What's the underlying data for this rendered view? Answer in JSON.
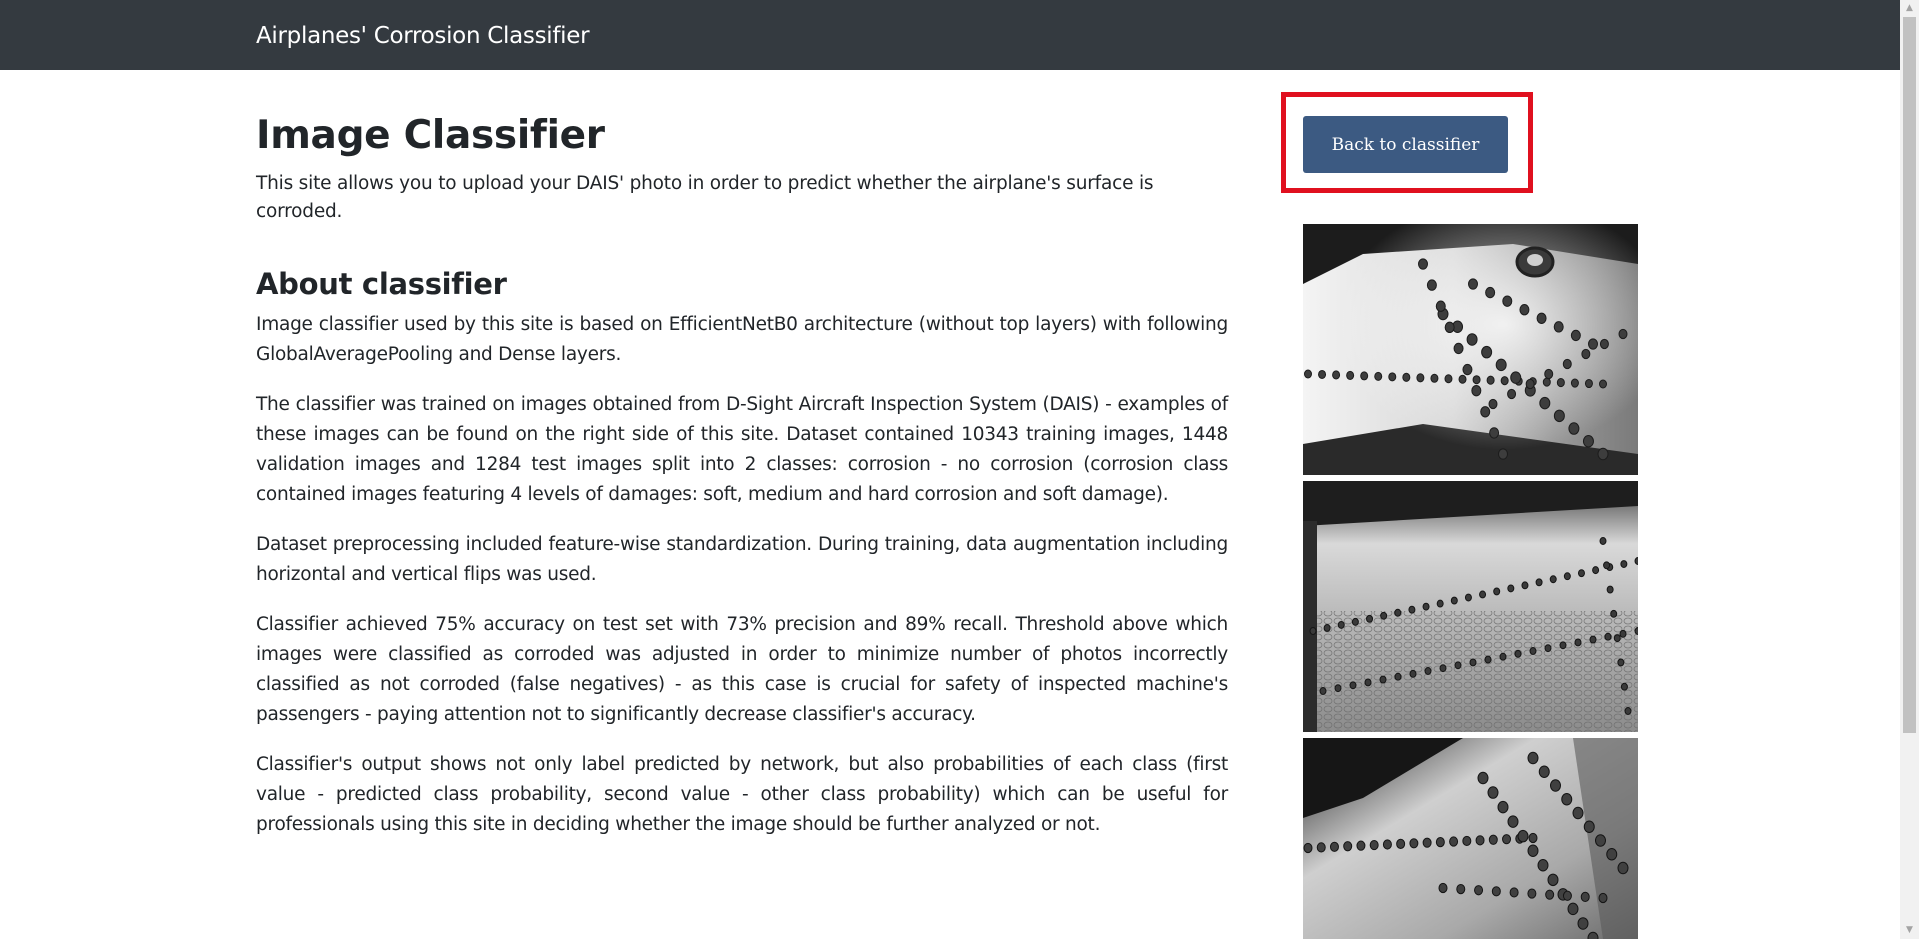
{
  "navbar": {
    "brand": "Airplanes' Corrosion Classifier"
  },
  "header": {
    "title": "Image Classifier",
    "lead": "This site allows you to upload your DAIS' photo in order to predict whether the airplane's surface is corroded."
  },
  "about": {
    "heading": "About classifier",
    "paragraphs": [
      "Image classifier used by this site is based on EfficientNetB0 architecture (without top layers) with following GlobalAveragePooling and Dense layers.",
      "The classifier was trained on images obtained from D-Sight Aircraft Inspection System (DAIS) - examples of these images can be found on the right side of this site. Dataset contained 10343 training images, 1448 validation images and 1284 test images split into 2 classes: corrosion - no corrosion (corrosion class contained images featuring 4 levels of damages: soft, medium and hard corrosion and soft damage).",
      "Dataset preprocessing included feature-wise standardization. During training, data augmentation including horizontal and vertical flips was used.",
      "Classifier achieved 75% accuracy on test set with 73% precision and 89% recall. Threshold above which images were classified as corroded was adjusted in order to minimize number of photos incorrectly classified as not corroded (false negatives) - as this case is crucial for safety of inspected machine's passengers - paying attention not to significantly decrease classifier's accuracy.",
      "Classifier's output shows not only label predicted by network, but also probabilities of each class (first value - predicted class probability, second value - other class probability) which can be useful for professionals using this site in deciding whether the image should be further analyzed or not."
    ]
  },
  "sidebar": {
    "back_button_label": "Back to classifier",
    "highlight_color": "#e0101f",
    "button_color": "#3c5a82"
  },
  "colors": {
    "navbar": "#343a40",
    "text": "#212529"
  }
}
